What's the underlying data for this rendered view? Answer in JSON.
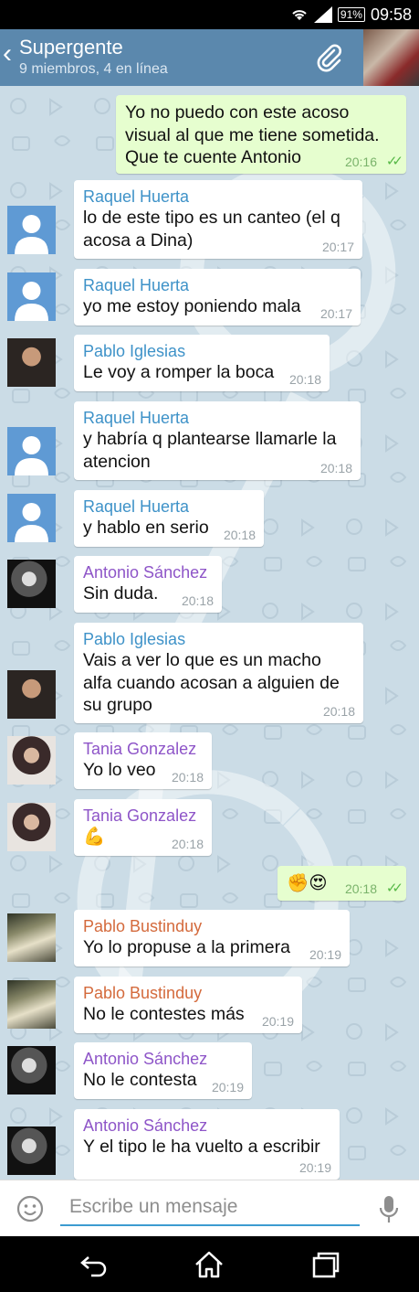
{
  "status_bar": {
    "battery": "91%",
    "time": "09:58",
    "icons": [
      "wifi-icon",
      "signal-icon",
      "battery-icon"
    ]
  },
  "header": {
    "title": "Supergente",
    "subtitle": "9 miembros, 4 en línea",
    "icons": [
      "back-icon",
      "attach-icon",
      "group-photo"
    ]
  },
  "colors": {
    "header": "#5b88ad",
    "chat_background": "#cbdce6",
    "outgoing_bubble": "#e6fecf",
    "incoming_bubble": "#ffffff",
    "name_raquel": "#3e92c8",
    "name_pablo_iglesias": "#3e92c8",
    "name_antonio": "#8e55c8",
    "name_tania": "#8e55c8",
    "name_pablo_bustinduy": "#d46a3c",
    "input_underline": "#3c9bd0"
  },
  "messages": [
    {
      "direction": "out",
      "text": "Yo no puedo con este acoso visual al que me tiene sometida. Que te cuente Antonio",
      "time": "20:16",
      "read": true
    },
    {
      "direction": "in",
      "sender": "Raquel Huerta",
      "avatar": "default",
      "text": "lo de este tipo es un canteo (el q acosa a Dina)",
      "time": "20:17"
    },
    {
      "direction": "in",
      "sender": "Raquel Huerta",
      "avatar": "default",
      "text": "yo me estoy poniendo mala",
      "time": "20:17"
    },
    {
      "direction": "in",
      "sender": "Pablo Iglesias",
      "avatar": "photo",
      "text": "Le voy a romper la boca",
      "time": "20:18"
    },
    {
      "direction": "in",
      "sender": "Raquel Huerta",
      "avatar": "default",
      "text": "y habría q plantearse llamarle la atencion",
      "time": "20:18"
    },
    {
      "direction": "in",
      "sender": "Raquel Huerta",
      "avatar": "default",
      "text": "y hablo en serio",
      "time": "20:18"
    },
    {
      "direction": "in",
      "sender": "Antonio Sánchez",
      "avatar": "photo",
      "text": "Sin duda.",
      "time": "20:18"
    },
    {
      "direction": "in",
      "sender": "Pablo Iglesias",
      "avatar": "photo",
      "text": "Vais a ver lo que es un macho alfa cuando acosan a alguien de su grupo",
      "time": "20:18"
    },
    {
      "direction": "in",
      "sender": "Tania Gonzalez",
      "avatar": "photo",
      "text": "Yo lo veo",
      "time": "20:18"
    },
    {
      "direction": "in",
      "sender": "Tania Gonzalez",
      "avatar": "photo",
      "text": "💪",
      "time": "20:18"
    },
    {
      "direction": "out",
      "text": "✊😍",
      "time": "20:18",
      "read": true
    },
    {
      "direction": "in",
      "sender": "Pablo Bustinduy",
      "avatar": "photo",
      "text": "Yo lo propuse a la primera",
      "time": "20:19"
    },
    {
      "direction": "in",
      "sender": "Pablo Bustinduy",
      "avatar": "photo",
      "text": "No le contestes más",
      "time": "20:19"
    },
    {
      "direction": "in",
      "sender": "Antonio Sánchez",
      "avatar": "photo",
      "text": "No le contesta",
      "time": "20:19"
    },
    {
      "direction": "in",
      "sender": "Antonio Sánchez",
      "avatar": "photo",
      "text": "Y el tipo le ha vuelto a escribir",
      "time": "20:19"
    }
  ],
  "composer": {
    "placeholder": "Escribe un mensaje",
    "icons": [
      "emoji-icon",
      "mic-icon"
    ]
  },
  "nav_bar": {
    "icons": [
      "back-nav-icon",
      "home-icon",
      "recent-apps-icon"
    ]
  }
}
